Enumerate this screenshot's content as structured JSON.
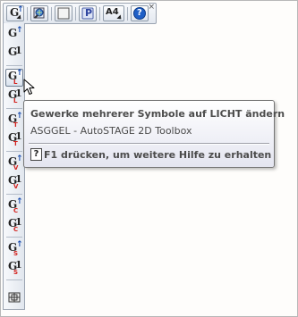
{
  "top_toolbar": {
    "buttons": [
      {
        "name": "g-arrow-dropdown-button",
        "label": "G"
      },
      {
        "name": "zoom-globe-button",
        "label": ""
      },
      {
        "name": "blank-sheet-button",
        "label": ""
      },
      {
        "name": "p-button",
        "label": "P"
      },
      {
        "name": "a4-dropdown-button",
        "label": "A4"
      },
      {
        "name": "help-button",
        "label": "?"
      }
    ],
    "close_label": "×"
  },
  "side_toolbar": {
    "groups": [
      {
        "items": [
          {
            "g": "G",
            "mark": "arrow",
            "sub": ""
          },
          {
            "g": "G",
            "mark": "1",
            "sub": ""
          }
        ]
      },
      {
        "items": [
          {
            "g": "G",
            "mark": "arrow",
            "sub": "L"
          },
          {
            "g": "G",
            "mark": "1",
            "sub": "L"
          }
        ]
      },
      {
        "items": [
          {
            "g": "G",
            "mark": "arrow",
            "sub": "T"
          },
          {
            "g": "G",
            "mark": "1",
            "sub": "T"
          }
        ]
      },
      {
        "items": [
          {
            "g": "G",
            "mark": "arrow",
            "sub": "V"
          },
          {
            "g": "G",
            "mark": "1",
            "sub": "V"
          }
        ]
      },
      {
        "items": [
          {
            "g": "G",
            "mark": "arrow",
            "sub": "C"
          },
          {
            "g": "G",
            "mark": "1",
            "sub": "C"
          }
        ]
      },
      {
        "items": [
          {
            "g": "G",
            "mark": "arrow",
            "sub": "S"
          },
          {
            "g": "G",
            "mark": "1",
            "sub": "S"
          }
        ]
      }
    ],
    "hovered": "G-arrow-L"
  },
  "tooltip": {
    "title": "Gewerke mehrerer Symbole auf LICHT ändern",
    "subtitle": "ASGGEL - AutoSTAGE 2D Toolbox",
    "help_icon": "?",
    "help_text": "F1 drücken, um weitere Hilfe zu erhalten"
  },
  "colors": {
    "accent_blue": "#1d4fb0",
    "sub_red": "#d4231f",
    "help_blue": "#1f5fc6"
  }
}
